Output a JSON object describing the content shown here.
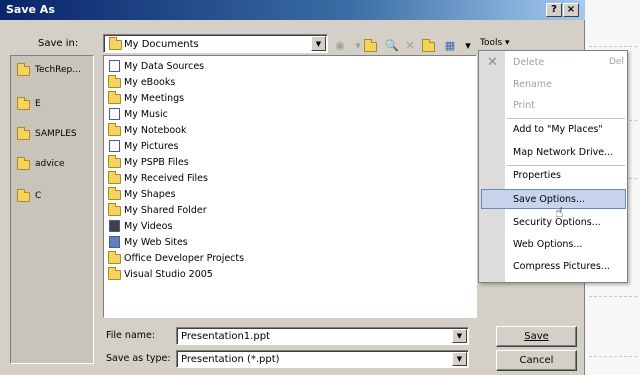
{
  "dialog": {
    "title": "Save As",
    "help_label": "?",
    "close_label": "×"
  },
  "save_in": {
    "label": "Save in:",
    "value": "My Documents"
  },
  "toolbar": {
    "tools_label": "Tools ▾",
    "icons": [
      "back-icon",
      "up-folder-icon",
      "search-web-icon",
      "delete-icon",
      "new-folder-icon",
      "views-icon"
    ]
  },
  "places": [
    "TechRep...",
    "E",
    "SAMPLES",
    "advice",
    "C"
  ],
  "files": [
    {
      "name": "My Data Sources",
      "icon": "special-folder"
    },
    {
      "name": "My eBooks",
      "icon": "folder"
    },
    {
      "name": "My Meetings",
      "icon": "folder"
    },
    {
      "name": "My Music",
      "icon": "special-folder"
    },
    {
      "name": "My Notebook",
      "icon": "folder"
    },
    {
      "name": "My Pictures",
      "icon": "special-folder"
    },
    {
      "name": "My PSPB Files",
      "icon": "folder"
    },
    {
      "name": "My Received Files",
      "icon": "folder"
    },
    {
      "name": "My Shapes",
      "icon": "folder"
    },
    {
      "name": "My Shared Folder",
      "icon": "folder"
    },
    {
      "name": "My Videos",
      "icon": "special-folder"
    },
    {
      "name": "My Web Sites",
      "icon": "special-folder"
    },
    {
      "name": "Office Developer Projects",
      "icon": "folder"
    },
    {
      "name": "Visual Studio 2005",
      "icon": "folder"
    }
  ],
  "file_name": {
    "label": "File name:",
    "value": "Presentation1.ppt"
  },
  "save_as_type": {
    "label": "Save as type:",
    "value": "Presentation (*.ppt)"
  },
  "buttons": {
    "save": "Save",
    "cancel": "Cancel"
  },
  "tools_menu": {
    "items": [
      {
        "label": "Delete",
        "shortcut": "Del",
        "disabled": true
      },
      {
        "label": "Rename",
        "disabled": true
      },
      {
        "label": "Print",
        "disabled": true
      },
      {
        "label": "Add to \"My Places\"",
        "disabled": false
      },
      {
        "label": "Map Network Drive...",
        "disabled": false
      },
      {
        "label": "Properties",
        "disabled": false
      },
      {
        "label": "Save Options...",
        "disabled": false,
        "highlighted": true
      },
      {
        "label": "Security Options...",
        "disabled": false
      },
      {
        "label": "Web Options...",
        "disabled": false
      },
      {
        "label": "Compress Pictures...",
        "disabled": false
      }
    ]
  },
  "colors": {
    "title_gradient_start": "#0a246a",
    "dialog_face": "#d4d0c8",
    "menu_highlight": "#c8d4ec"
  }
}
